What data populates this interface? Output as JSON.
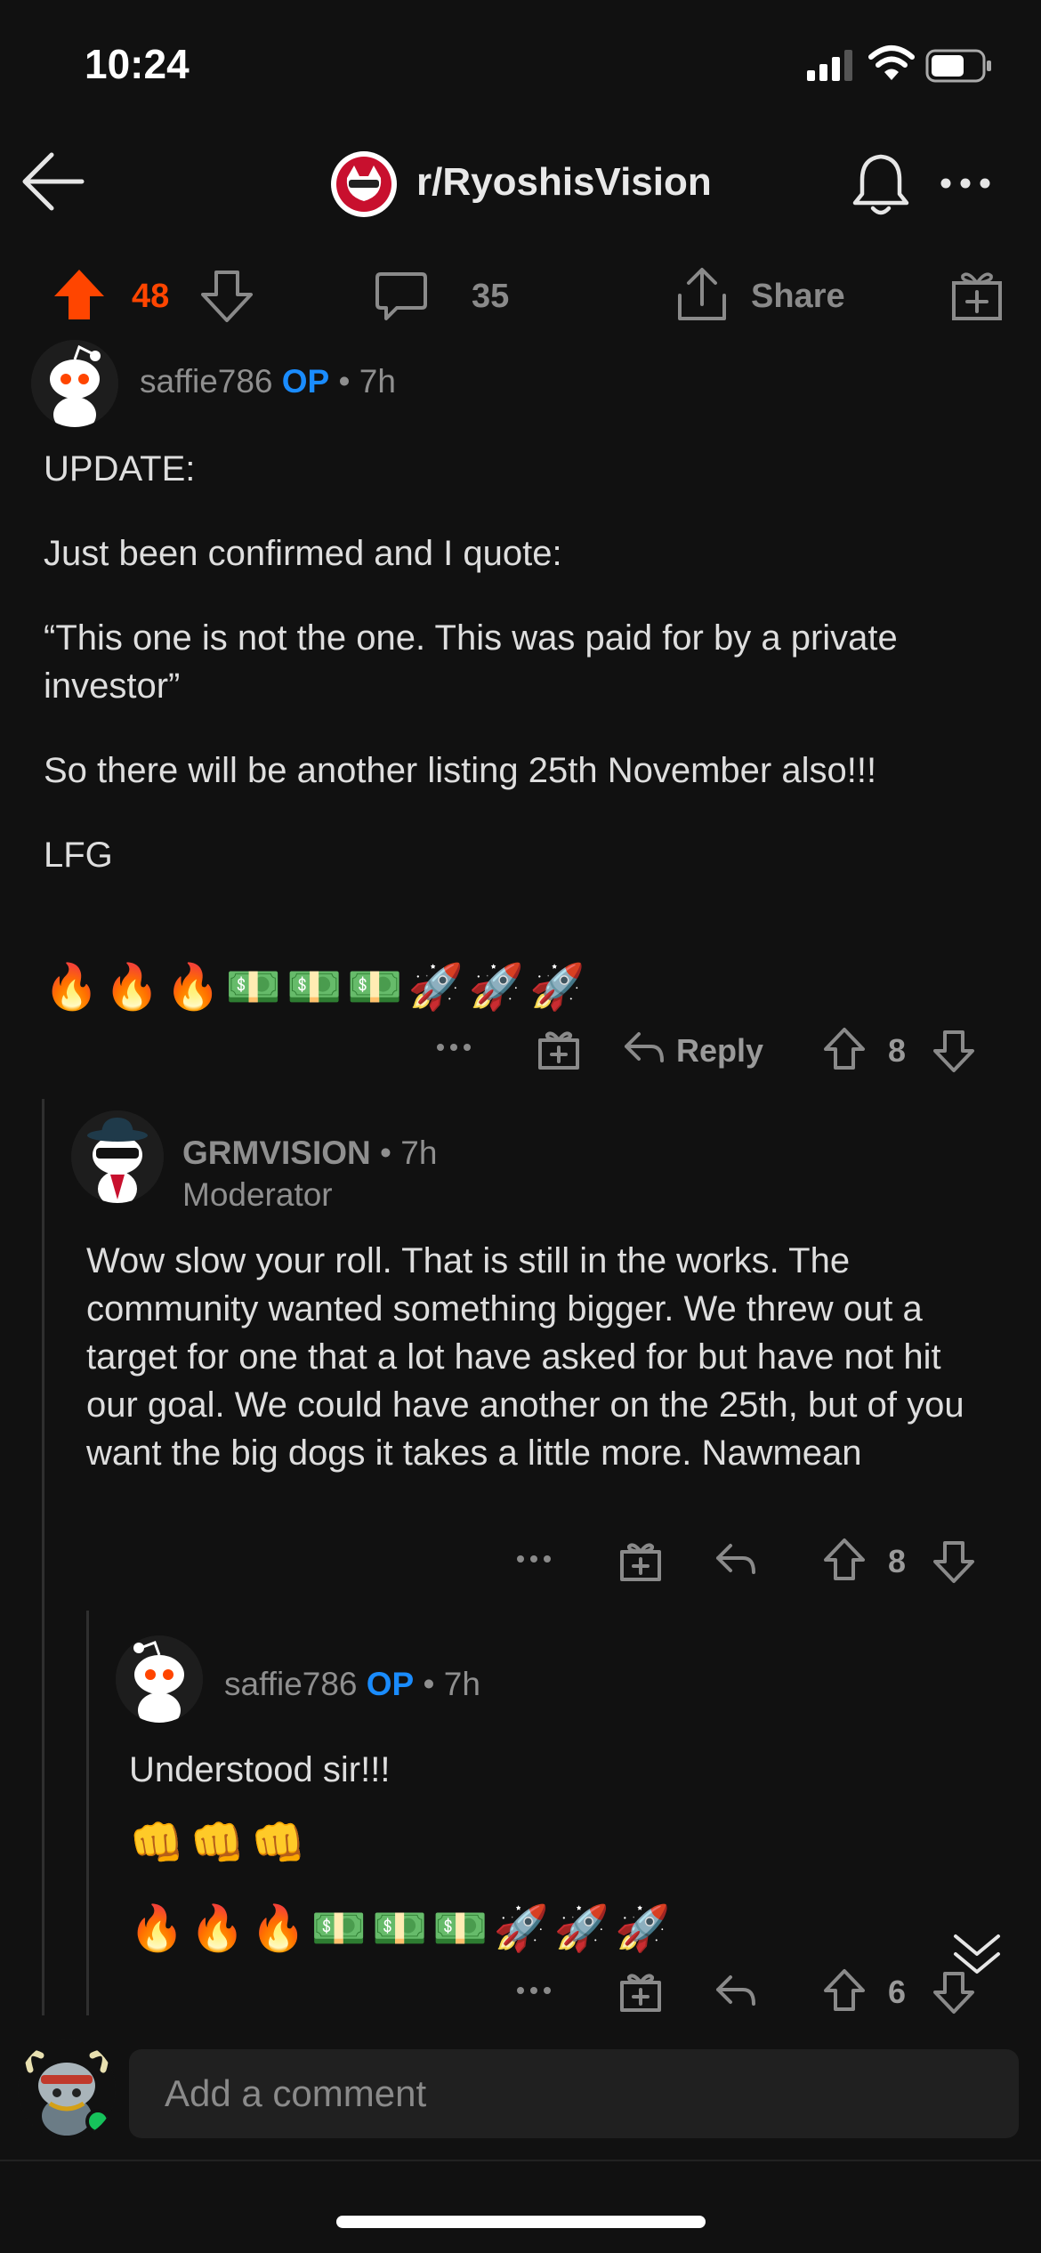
{
  "status_bar": {
    "time": "10:24"
  },
  "header": {
    "subreddit": "r/RyoshisVision"
  },
  "post_actions": {
    "upvotes": "48",
    "comments": "35",
    "share_label": "Share"
  },
  "comments": [
    {
      "user": "saffie786",
      "op_badge": "OP",
      "time": "• 7h",
      "paragraphs": [
        "UPDATE:",
        "Just been confirmed and I quote:",
        "“This one is not the one. This was paid for by a private investor”",
        "So there will be another listing 25th November also!!!",
        "LFG"
      ],
      "emojis": "🔥🔥🔥💵💵💵🚀🚀🚀",
      "reply_label": "Reply",
      "score": "8"
    },
    {
      "user": "GRMVISION",
      "time": "• 7h",
      "role": "Moderator",
      "body": "Wow slow your roll. That is still in the works. The community wanted something bigger. We threw out a target for one that a lot have asked for but have not hit our goal. We could have another on the 25th, but of you want the big dogs it takes a little more. Nawmean",
      "score": "8"
    },
    {
      "user": "saffie786",
      "op_badge": "OP",
      "time": "• 7h",
      "body": "Understood sir!!!",
      "emojis_1": "👊👊👊",
      "emojis_2": "🔥🔥🔥💵💵💵🚀🚀🚀",
      "score": "6"
    }
  ],
  "composer": {
    "placeholder": "Add a comment"
  }
}
